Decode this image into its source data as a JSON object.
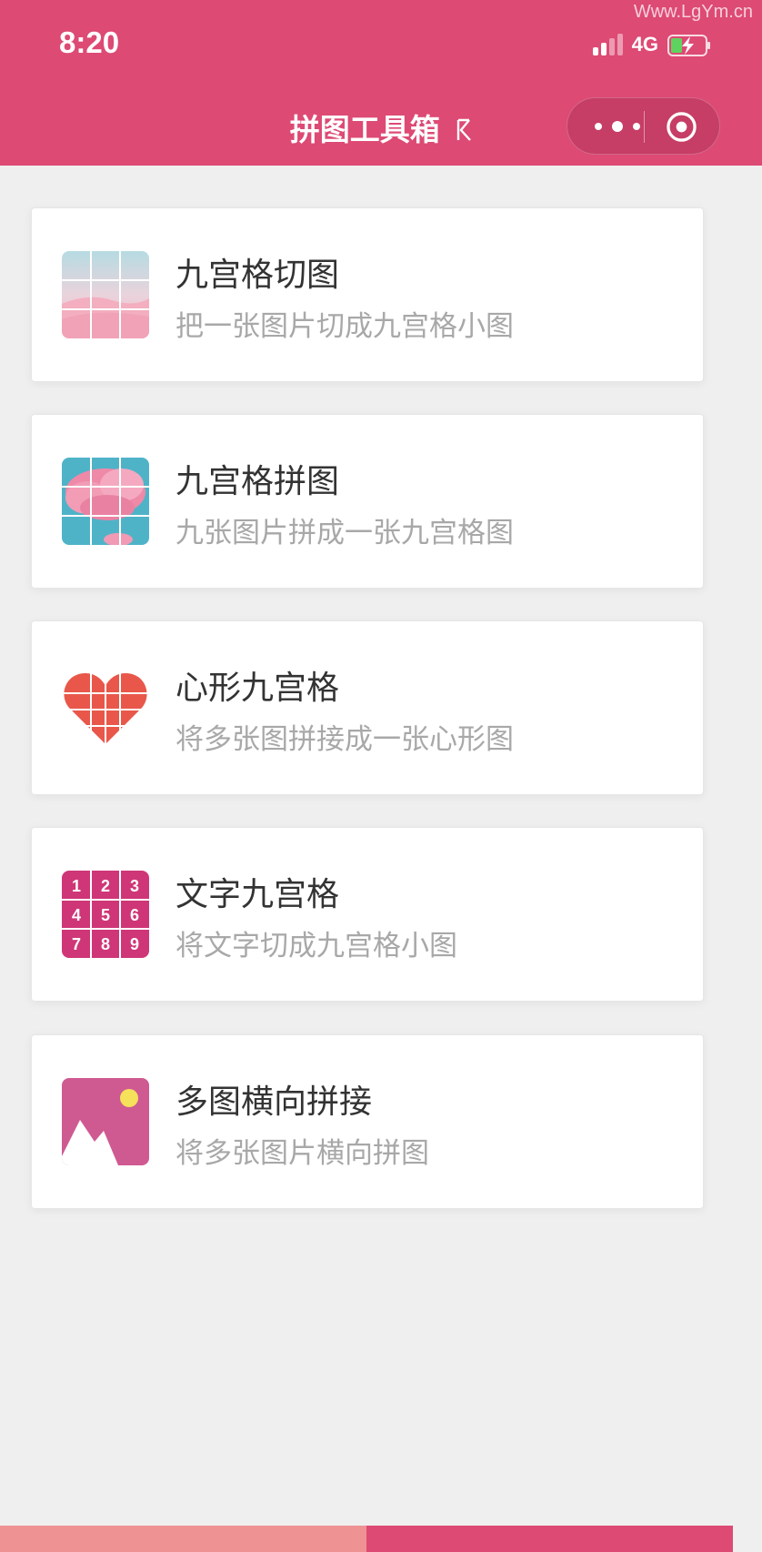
{
  "watermark": "Www.LgYm.cn",
  "status": {
    "time": "8:20",
    "network": "4G"
  },
  "header": {
    "title": "拼图工具箱"
  },
  "capsule": {
    "more_icon": "more-dots-icon",
    "close_icon": "target-circle-icon"
  },
  "cards": [
    {
      "title": "九宫格切图",
      "subtitle": "把一张图片切成九宫格小图",
      "icon": "sky-grid-icon"
    },
    {
      "title": "九宫格拼图",
      "subtitle": "九张图片拼成一张九宫格图",
      "icon": "cloud-grid-icon"
    },
    {
      "title": "心形九宫格",
      "subtitle": "将多张图拼接成一张心形图",
      "icon": "heart-grid-icon"
    },
    {
      "title": "文字九宫格",
      "subtitle": "将文字切成九宫格小图",
      "icon": "number-grid-icon",
      "digits": [
        "1",
        "2",
        "3",
        "4",
        "5",
        "6",
        "7",
        "8",
        "9"
      ]
    },
    {
      "title": "多图横向拼接",
      "subtitle": "将多张图片横向拼图",
      "icon": "landscape-image-icon"
    }
  ],
  "colors": {
    "brand": "#dd4a74",
    "footer_left": "#ef9294",
    "heart": "#e9574a",
    "number_grid": "#cf3677",
    "image_icon": "#cf5a92"
  }
}
